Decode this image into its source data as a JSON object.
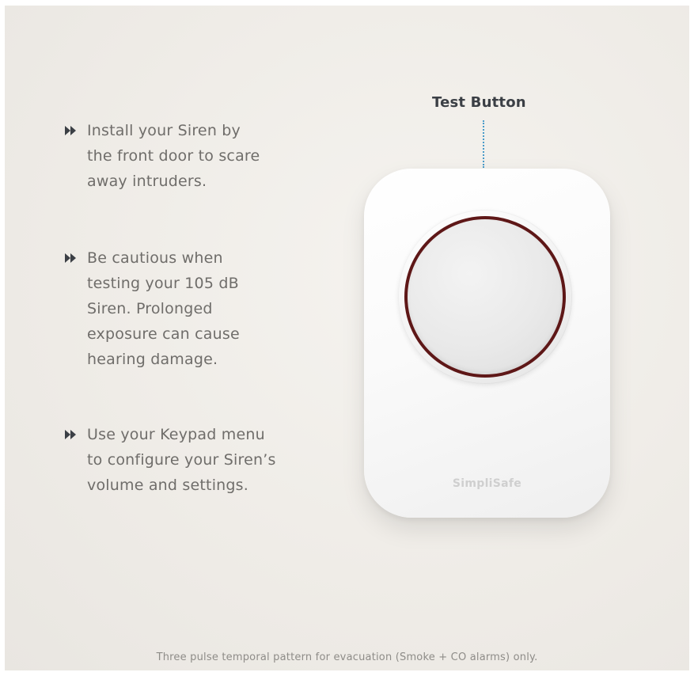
{
  "tips": [
    {
      "icon": "double-arrow-icon",
      "text": "Install your Siren by\nthe front door to scare\naway intruders."
    },
    {
      "icon": "double-arrow-icon",
      "text": "Be cautious when\ntesting your 105 dB\nSiren. Prolonged\nexposure can cause\nhearing damage."
    },
    {
      "icon": "double-arrow-icon",
      "text": "Use your Keypad menu\nto configure your Siren’s\nvolume and settings."
    }
  ],
  "callout": {
    "label": "Test Button",
    "line_color": "#4a9bc9"
  },
  "device": {
    "logo": "SimpliSafe",
    "ring_color": "#6a1a1a"
  },
  "footnote": "Three pulse temporal pattern for evacuation (Smoke + CO alarms) only.",
  "colors": {
    "background": "#efece7",
    "text": "#6f6d6a",
    "heading": "#3b3f45"
  }
}
